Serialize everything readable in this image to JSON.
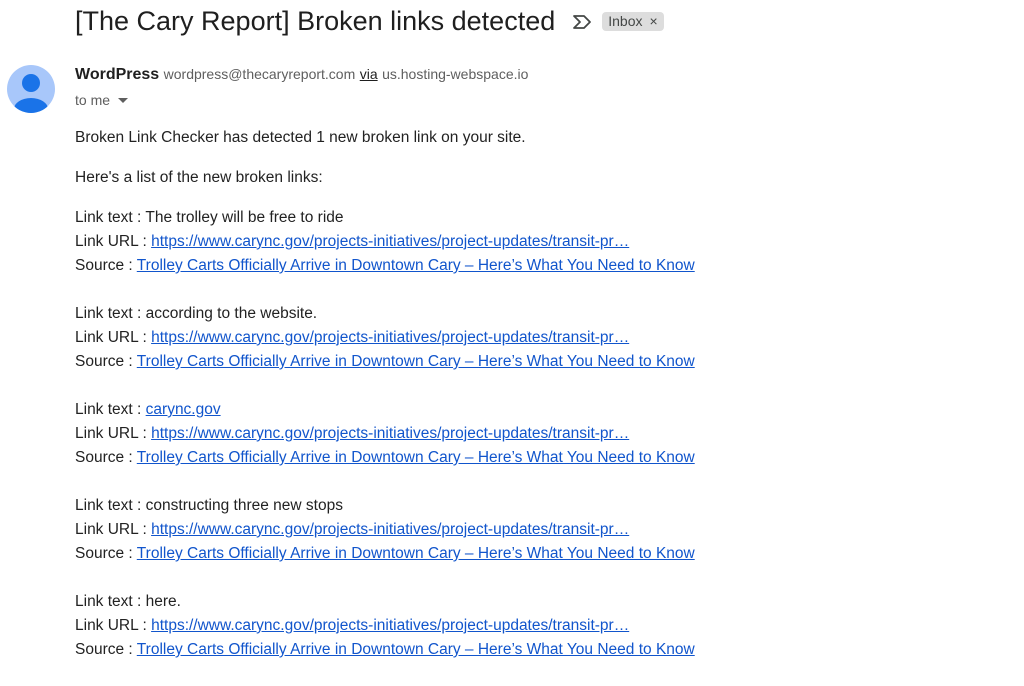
{
  "email": {
    "subject": "[The Cary Report] Broken links detected",
    "label": "Inbox",
    "label_remove": "×",
    "sender": {
      "name": "WordPress",
      "email": "wordpress@thecaryreport.com",
      "via": "via",
      "via_host": "us.hosting-webspace.io"
    },
    "to": "to me",
    "intro": "Broken Link Checker has detected 1 new broken link on your site.",
    "list_intro": "Here's a list of the new broken links:",
    "field_labels": {
      "link_text": "Link text : ",
      "link_url": "Link URL : ",
      "source": "Source : "
    },
    "links": [
      {
        "text": "The trolley will be free to ride",
        "url": "https://www.carync.gov/projects-initiatives/project-updates/transit-pr…",
        "source": "Trolley Carts Officially Arrive in Downtown Cary – Here’s What You Need to Know"
      },
      {
        "text": "according to the website.",
        "url": "https://www.carync.gov/projects-initiatives/project-updates/transit-pr…",
        "source": "Trolley Carts Officially Arrive in Downtown Cary – Here’s What You Need to Know"
      },
      {
        "text": "carync.gov",
        "text_is_link": true,
        "url": "https://www.carync.gov/projects-initiatives/project-updates/transit-pr…",
        "source": "Trolley Carts Officially Arrive in Downtown Cary – Here’s What You Need to Know"
      },
      {
        "text": "constructing three new stops",
        "url": "https://www.carync.gov/projects-initiatives/project-updates/transit-pr…",
        "source": "Trolley Carts Officially Arrive in Downtown Cary – Here’s What You Need to Know"
      },
      {
        "text": "here.",
        "url": "https://www.carync.gov/projects-initiatives/project-updates/transit-pr…",
        "source": "Trolley Carts Officially Arrive in Downtown Cary – Here’s What You Need to Know"
      }
    ]
  },
  "colors": {
    "link": "#1155cc",
    "avatar_bg": "#a8c7fa",
    "avatar_fg": "#1a73e8",
    "chip_bg": "#dddddd"
  },
  "icons": {
    "importance": "importance-marker-icon",
    "avatar": "person-avatar-icon",
    "caret": "chevron-down-icon"
  }
}
